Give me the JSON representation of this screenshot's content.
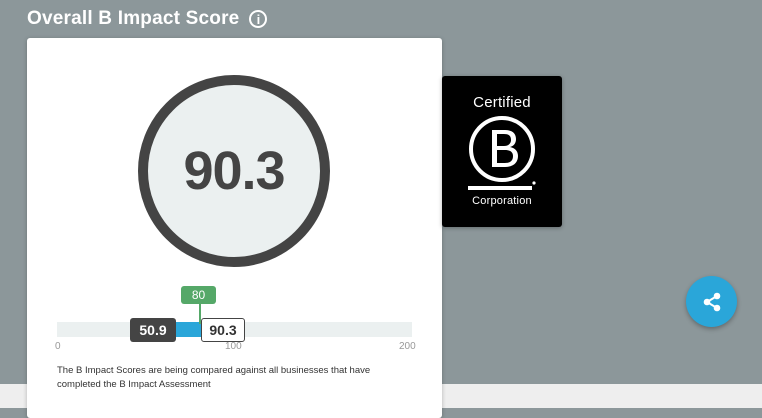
{
  "header": {
    "title": "Overall B Impact Score",
    "info_icon": "info-icon",
    "info_glyph": "i"
  },
  "score": {
    "value": "90.3"
  },
  "distribution": {
    "median_label": "80",
    "median_value": 80,
    "benchmark_label": "50.9",
    "company_label": "90.3",
    "range": [
      0,
      200
    ],
    "ticks": [
      "0",
      "100",
      "200"
    ],
    "colors": {
      "fill": "#2aa6d9",
      "median": "#55a868",
      "dark": "#444444"
    }
  },
  "description": "The B Impact Scores are being compared against all businesses that have completed the B Impact Assessment",
  "badge": {
    "top": "Certified",
    "bottom": "Corporation",
    "logo_icon": "b-corp-logo-icon"
  },
  "share": {
    "icon": "share-icon",
    "color": "#2aa6d9"
  }
}
